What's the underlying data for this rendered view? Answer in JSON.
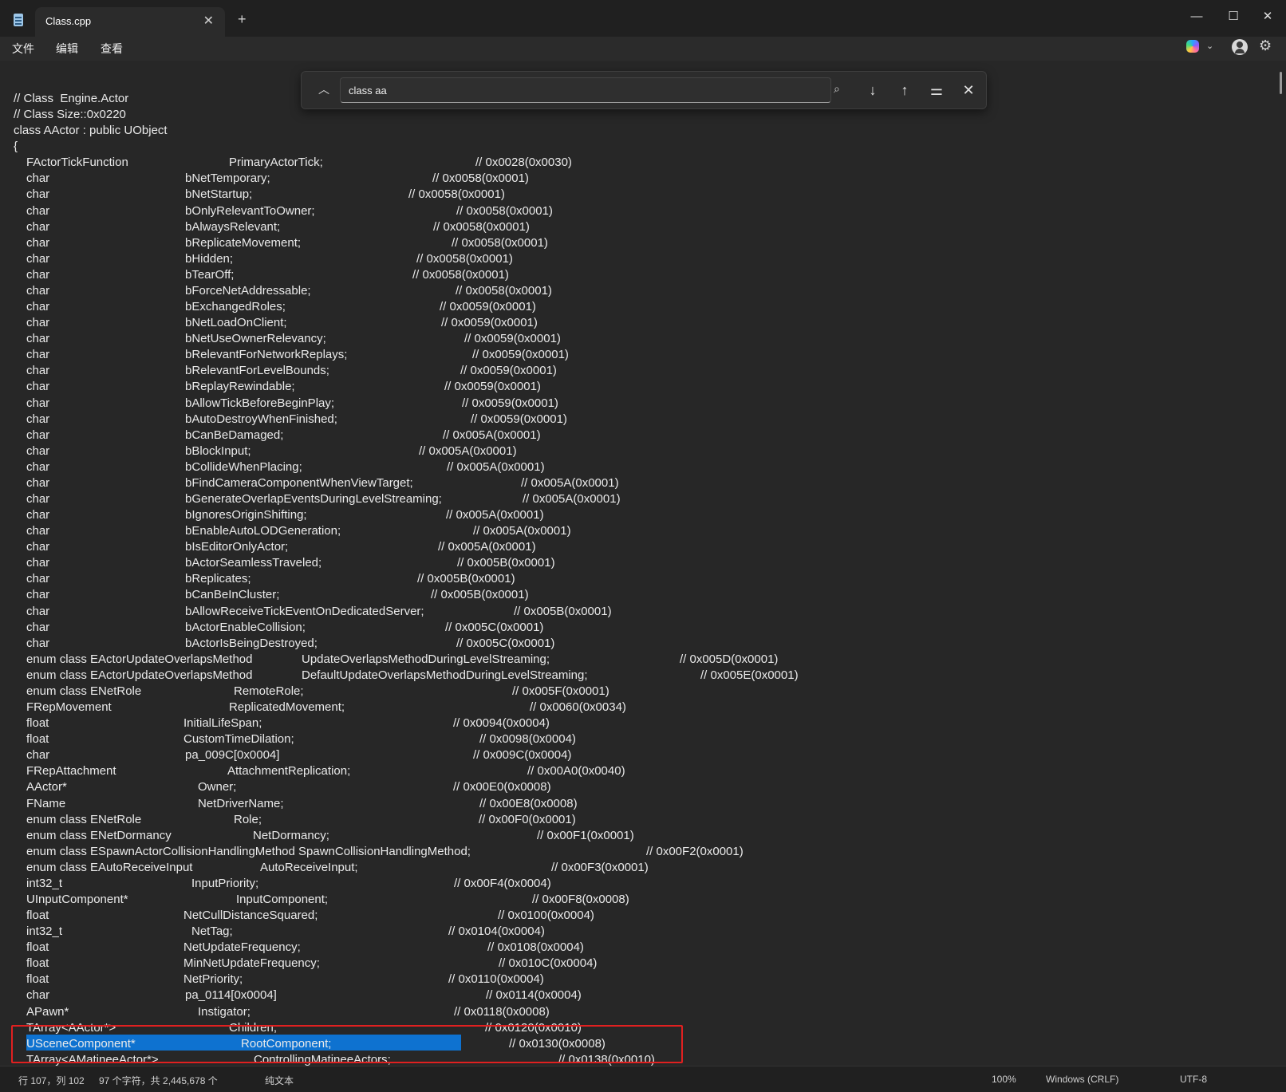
{
  "window": {
    "tab_title": "Class.cpp",
    "tab_close": "✕",
    "new_tab": "+",
    "minimize": "—",
    "maximize": "☐",
    "close": "✕"
  },
  "menu": {
    "file": "文件",
    "edit": "编辑",
    "view": "查看"
  },
  "find": {
    "query": "class aa"
  },
  "code_lines": [
    "// Class  Engine.Actor",
    "// Class Size::0x0220",
    "class AActor : public UObject",
    "{",
    "FActorTickFunction",
    "PrimaryActorTick;",
    "// 0x0028(0x0030)",
    "char",
    "bNetTemporary;",
    "// 0x0058(0x0001)",
    "char",
    "bNetStartup;",
    "// 0x0058(0x0001)",
    "char",
    "bOnlyRelevantToOwner;",
    "// 0x0058(0x0001)",
    "char",
    "bAlwaysRelevant;",
    "// 0x0058(0x0001)",
    "char",
    "bReplicateMovement;",
    "// 0x0058(0x0001)",
    "char",
    "bHidden;",
    "// 0x0058(0x0001)",
    "char",
    "bTearOff;",
    "// 0x0058(0x0001)",
    "char",
    "bForceNetAddressable;",
    "// 0x0058(0x0001)",
    "char",
    "bExchangedRoles;",
    "// 0x0059(0x0001)",
    "char",
    "bNetLoadOnClient;",
    "// 0x0059(0x0001)",
    "char",
    "bNetUseOwnerRelevancy;",
    "// 0x0059(0x0001)",
    "char",
    "bRelevantForNetworkReplays;",
    "// 0x0059(0x0001)",
    "char",
    "bRelevantForLevelBounds;",
    "// 0x0059(0x0001)",
    "char",
    "bReplayRewindable;",
    "// 0x0059(0x0001)",
    "char",
    "bAllowTickBeforeBeginPlay;",
    "// 0x0059(0x0001)",
    "char",
    "bAutoDestroyWhenFinished;",
    "// 0x0059(0x0001)",
    "char",
    "bCanBeDamaged;",
    "// 0x005A(0x0001)",
    "char",
    "bBlockInput;",
    "// 0x005A(0x0001)",
    "char",
    "bCollideWhenPlacing;",
    "// 0x005A(0x0001)",
    "char",
    "bFindCameraComponentWhenViewTarget;",
    "// 0x005A(0x0001)",
    "char",
    "bGenerateOverlapEventsDuringLevelStreaming;",
    "// 0x005A(0x0001)",
    "char",
    "bIgnoresOriginShifting;",
    "// 0x005A(0x0001)",
    "char",
    "bEnableAutoLODGeneration;",
    "// 0x005A(0x0001)",
    "char",
    "bIsEditorOnlyActor;",
    "// 0x005A(0x0001)",
    "char",
    "bActorSeamlessTraveled;",
    "// 0x005B(0x0001)",
    "char",
    "bReplicates;",
    "// 0x005B(0x0001)",
    "char",
    "bCanBeInCluster;",
    "// 0x005B(0x0001)",
    "char",
    "bAllowReceiveTickEventOnDedicatedServer;",
    "// 0x005B(0x0001)",
    "char",
    "bActorEnableCollision;",
    "// 0x005C(0x0001)",
    "char",
    "bActorIsBeingDestroyed;",
    "// 0x005C(0x0001)",
    "enum class EActorUpdateOverlapsMethod",
    "UpdateOverlapsMethodDuringLevelStreaming;",
    "// 0x005D(0x0001)",
    "enum class EActorUpdateOverlapsMethod",
    "DefaultUpdateOverlapsMethodDuringLevelStreaming;",
    "// 0x005E(0x0001)",
    "enum class ENetRole",
    "RemoteRole;",
    "// 0x005F(0x0001)",
    "FRepMovement",
    "ReplicatedMovement;",
    "// 0x0060(0x0034)",
    "float",
    "InitialLifeSpan;",
    "// 0x0094(0x0004)",
    "float",
    "CustomTimeDilation;",
    "// 0x0098(0x0004)",
    "char",
    "pa_009C[0x0004]",
    "// 0x009C(0x0004)",
    "FRepAttachment",
    "AttachmentReplication;",
    "// 0x00A0(0x0040)",
    "AActor*",
    "Owner;",
    "// 0x00E0(0x0008)",
    "FName",
    "NetDriverName;",
    "// 0x00E8(0x0008)",
    "enum class ENetRole",
    "Role;",
    "// 0x00F0(0x0001)",
    "enum class ENetDormancy",
    "NetDormancy;",
    "// 0x00F1(0x0001)",
    "enum class ESpawnActorCollisionHandlingMethod SpawnCollisionHandlingMethod;",
    "// 0x00F2(0x0001)",
    "enum class EAutoReceiveInput",
    "AutoReceiveInput;",
    "// 0x00F3(0x0001)",
    "int32_t",
    "InputPriority;",
    "// 0x00F4(0x0004)",
    "UInputComponent*",
    "InputComponent;",
    "// 0x00F8(0x0008)",
    "float",
    "NetCullDistanceSquared;",
    "// 0x0100(0x0004)",
    "int32_t",
    "NetTag;",
    "// 0x0104(0x0004)",
    "float",
    "NetUpdateFrequency;",
    "// 0x0108(0x0004)",
    "float",
    "MinNetUpdateFrequency;",
    "// 0x010C(0x0004)",
    "float",
    "NetPriority;",
    "// 0x0110(0x0004)",
    "char",
    "pa_0114[0x0004]",
    "// 0x0114(0x0004)",
    "APawn*",
    "Instigator;",
    "// 0x0118(0x0008)",
    "TArray<AActor*>",
    "Children;",
    "// 0x0120(0x0010)",
    "USceneComponent*",
    "RootComponent;",
    "// 0x0130(0x0008)",
    "TArray<AMatineeActor*>",
    "ControllingMatineeActors;",
    "// 0x0138(0x0010)"
  ],
  "status": {
    "position": "行 107，列 102",
    "chars": "97 个字符，共 2,445,678 个",
    "format": "纯文本",
    "zoom": "100%",
    "line_ending": "Windows (CRLF)",
    "encoding": "UTF-8"
  }
}
